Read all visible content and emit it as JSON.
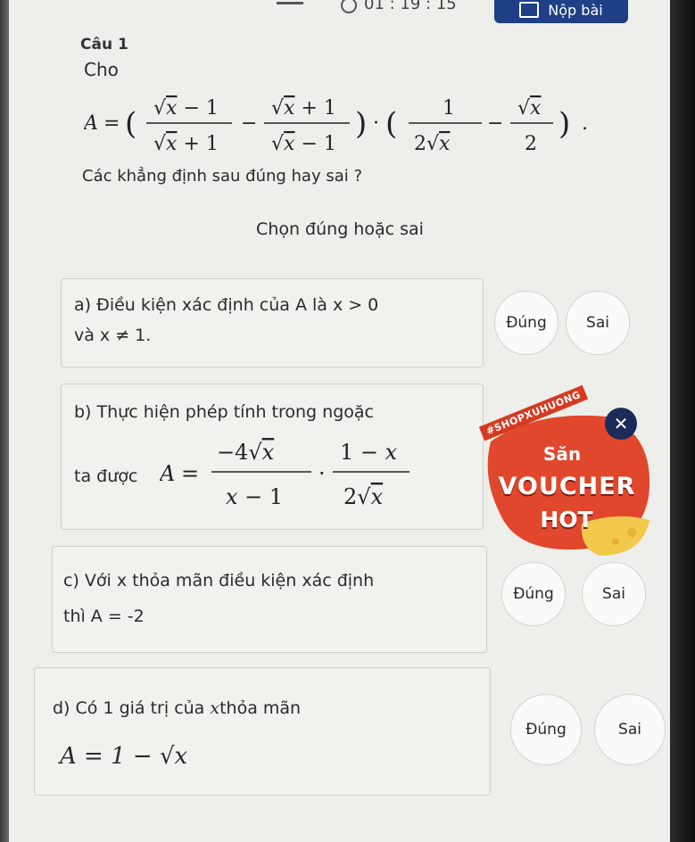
{
  "statusbar": {
    "timer": "01 : 19 : 15"
  },
  "submit": {
    "label": "Nộp bài"
  },
  "question": {
    "title": "Câu 1",
    "intro": "Cho",
    "formula_lhs": "A",
    "statement": "Các khẳng định sau đúng hay sai ?",
    "instruction": "Chọn đúng hoặc sai"
  },
  "options": [
    {
      "label": "a)",
      "line1": "Điều kiện xác định của A là x > 0",
      "line2": "và x ≠ 1.",
      "true_label": "Đúng",
      "false_label": "Sai"
    },
    {
      "label": "b)",
      "line1": "Thực hiện phép tính trong ngoặc",
      "line2_prefix": "ta được",
      "formula_lhs": "A"
    },
    {
      "label": "c)",
      "line1": "Với x thỏa mãn điều kiện xác định",
      "line2": "thì A = -2",
      "true_label": "Đúng",
      "false_label": "Sai"
    },
    {
      "label": "d)",
      "line1_prefix": "Có 1 giá trị của",
      "line1_var": "x",
      "line1_suffix": "thỏa mãn",
      "formula": "A = 1 − √x",
      "true_label": "Đúng",
      "false_label": "Sai"
    }
  ],
  "ad": {
    "tag": "#SHOPXUHUONG",
    "line1": "Săn",
    "line2": "VOUCHER",
    "line3": "HOT",
    "close_icon": "close-icon",
    "colors": {
      "red": "#e0472c",
      "gold": "#f2c94c",
      "navy": "#1d2b5a"
    }
  },
  "colors": {
    "accent": "#1f3f86",
    "background": "#eeeeea"
  }
}
